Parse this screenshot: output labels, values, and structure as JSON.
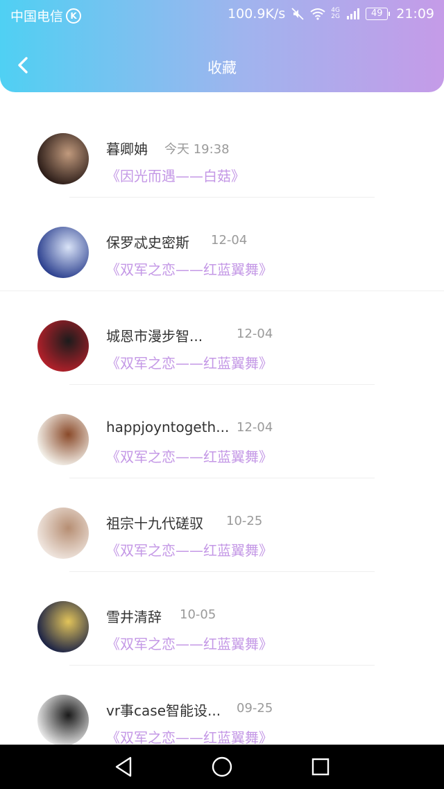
{
  "status_bar": {
    "carrier": "中国电信",
    "carrier_badge": "K",
    "speed": "100.9K/s",
    "network": "4G 2G",
    "battery": "49",
    "time": "21:09"
  },
  "header": {
    "title": "收藏",
    "back_icon": "chevron-left-icon"
  },
  "favorites": [
    {
      "name": "暮卿姌",
      "time": "今天 19:38",
      "title": "《因光而遇——白菇》",
      "avatar_colors": [
        "#2a1b17",
        "#c19a7d"
      ]
    },
    {
      "name": "保罗忒史密斯",
      "time": "12-04",
      "title": "《双军之恋——红蓝翼舞》",
      "avatar_colors": [
        "#2b3f8e",
        "#d9e3f7"
      ]
    },
    {
      "name": "城恩市漫步智...",
      "time": "12-04",
      "title": "《双军之恋——红蓝翼舞》",
      "avatar_colors": [
        "#b3202a",
        "#1c1c1c"
      ]
    },
    {
      "name": "happjoyntogeth...",
      "time": "12-04",
      "title": "《双军之恋——红蓝翼舞》",
      "avatar_colors": [
        "#f4f1ea",
        "#8a4a2a"
      ]
    },
    {
      "name": "祖宗十九代磋驭",
      "time": "10-25",
      "title": "《双军之恋——红蓝翼舞》",
      "avatar_colors": [
        "#f0e6df",
        "#b68e73"
      ]
    },
    {
      "name": "雪井清辞",
      "time": "10-05",
      "title": "《双军之恋——红蓝翼舞》",
      "avatar_colors": [
        "#1a2145",
        "#e2c45a"
      ]
    },
    {
      "name": "vr事case智能设...",
      "time": "09-25",
      "title": "《双军之恋——红蓝翼舞》",
      "avatar_colors": [
        "#e8e8e8",
        "#1a1a1a"
      ]
    }
  ],
  "system_nav": {
    "back": "triangle-back-icon",
    "home": "circle-home-icon",
    "recents": "square-recents-icon"
  }
}
